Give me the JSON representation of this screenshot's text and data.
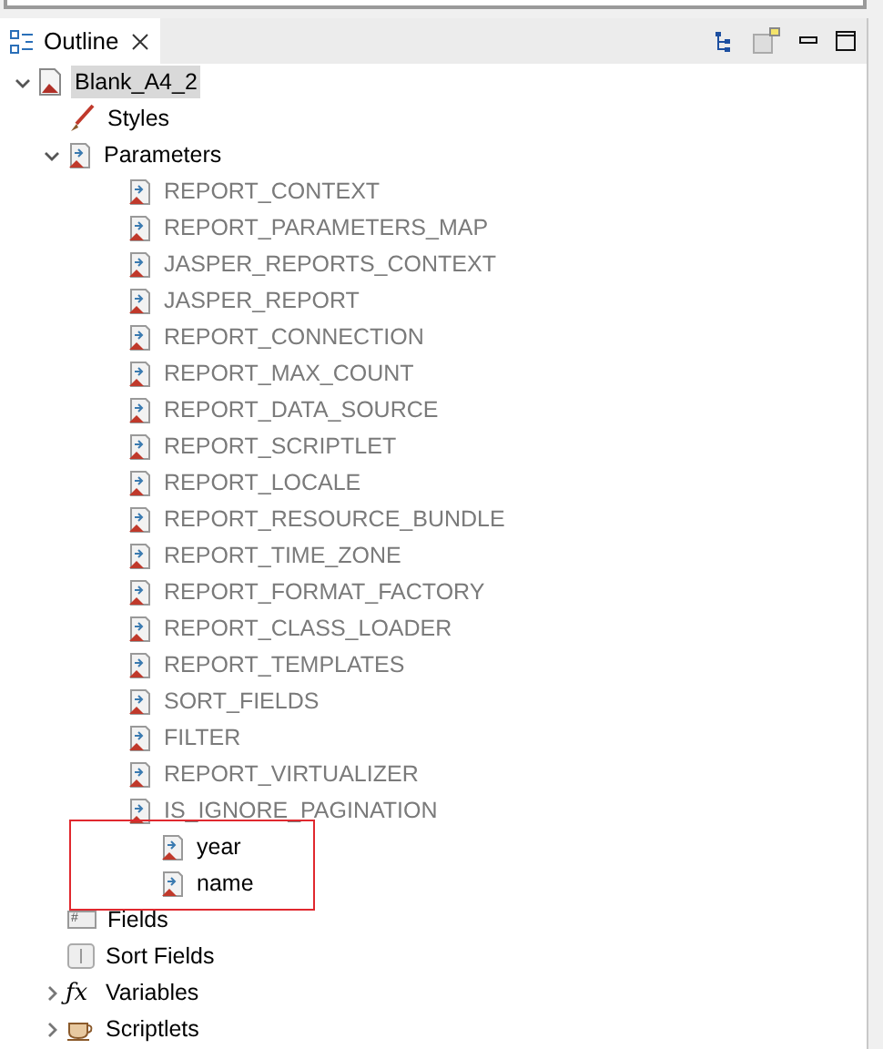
{
  "tab": {
    "label": "Outline",
    "selected": true
  },
  "tree": {
    "label": "Blank_A4_2",
    "kind": "report",
    "expanded": true,
    "selected": true,
    "children": [
      {
        "label": "Styles",
        "kind": "styles"
      },
      {
        "label": "Parameters",
        "kind": "parameters",
        "expanded": true,
        "children": [
          {
            "label": "REPORT_CONTEXT",
            "system": true
          },
          {
            "label": "REPORT_PARAMETERS_MAP",
            "system": true
          },
          {
            "label": "JASPER_REPORTS_CONTEXT",
            "system": true
          },
          {
            "label": "JASPER_REPORT",
            "system": true
          },
          {
            "label": "REPORT_CONNECTION",
            "system": true
          },
          {
            "label": "REPORT_MAX_COUNT",
            "system": true
          },
          {
            "label": "REPORT_DATA_SOURCE",
            "system": true
          },
          {
            "label": "REPORT_SCRIPTLET",
            "system": true
          },
          {
            "label": "REPORT_LOCALE",
            "system": true
          },
          {
            "label": "REPORT_RESOURCE_BUNDLE",
            "system": true
          },
          {
            "label": "REPORT_TIME_ZONE",
            "system": true
          },
          {
            "label": "REPORT_FORMAT_FACTORY",
            "system": true
          },
          {
            "label": "REPORT_CLASS_LOADER",
            "system": true
          },
          {
            "label": "REPORT_TEMPLATES",
            "system": true
          },
          {
            "label": "SORT_FIELDS",
            "system": true
          },
          {
            "label": "FILTER",
            "system": true
          },
          {
            "label": "REPORT_VIRTUALIZER",
            "system": true
          },
          {
            "label": "IS_IGNORE_PAGINATION",
            "system": true
          },
          {
            "label": "year",
            "system": false,
            "highlighted": true
          },
          {
            "label": "name",
            "system": false,
            "highlighted": true
          }
        ]
      },
      {
        "label": "Fields",
        "kind": "fields",
        "icon_text": "#"
      },
      {
        "label": "Sort Fields",
        "kind": "sort-fields"
      },
      {
        "label": "Variables",
        "kind": "variables",
        "icon_text": "ƒx",
        "expanded": false
      },
      {
        "label": "Scriptlets",
        "kind": "scriptlets",
        "expanded": false
      }
    ]
  }
}
